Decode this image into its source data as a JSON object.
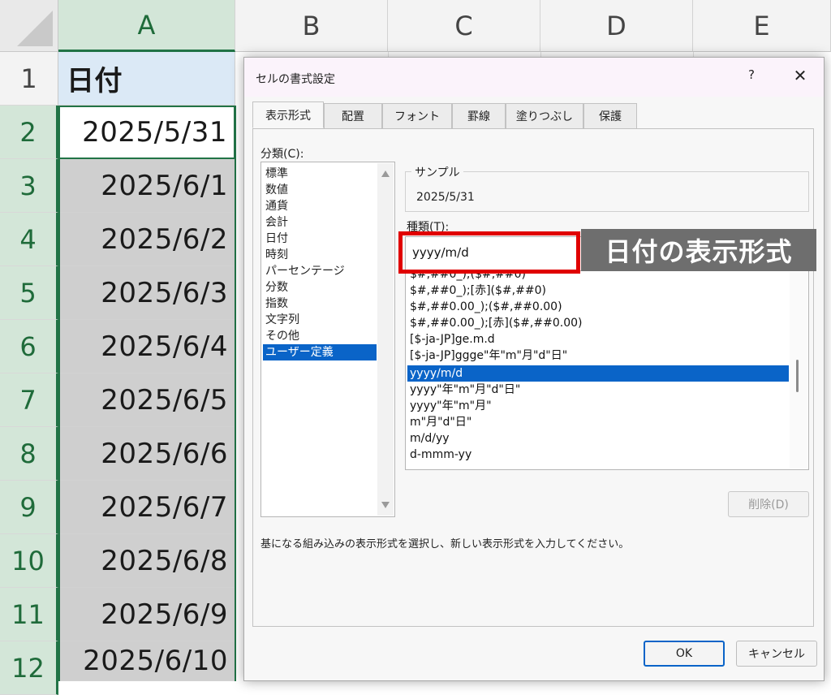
{
  "sheet": {
    "columns": [
      "A",
      "B",
      "C",
      "D",
      "E"
    ],
    "rows": [
      "1",
      "2",
      "3",
      "4",
      "5",
      "6",
      "7",
      "8",
      "9",
      "10",
      "11",
      "12"
    ],
    "cells": [
      "日付",
      "2025/5/31",
      "2025/6/1",
      "2025/6/2",
      "2025/6/3",
      "2025/6/4",
      "2025/6/5",
      "2025/6/6",
      "2025/6/7",
      "2025/6/8",
      "2025/6/9",
      "2025/6/10"
    ]
  },
  "dialog": {
    "title": "セルの書式設定",
    "help": "?",
    "close": "✕",
    "tabs": [
      "表示形式",
      "配置",
      "フォント",
      "罫線",
      "塗りつぶし",
      "保護"
    ],
    "category_label": "分類(C):",
    "categories": [
      "標準",
      "数値",
      "通貨",
      "会計",
      "日付",
      "時刻",
      "パーセンテージ",
      "分数",
      "指数",
      "文字列",
      "その他",
      "ユーザー定義"
    ],
    "selected_category": "ユーザー定義",
    "sample_label": "サンプル",
    "sample_value": "2025/5/31",
    "type_label": "種類(T):",
    "type_value": "yyyy/m/d",
    "formats": [
      "$#,##0_);($#,##0)",
      "$#,##0_);[赤]($#,##0)",
      "$#,##0.00_);($#,##0.00)",
      "$#,##0.00_);[赤]($#,##0.00)",
      "[$-ja-JP]ge.m.d",
      "[$-ja-JP]ggge\"年\"m\"月\"d\"日\"",
      "yyyy/m/d",
      "yyyy\"年\"m\"月\"d\"日\"",
      "yyyy\"年\"m\"月\"",
      "m\"月\"d\"日\"",
      "m/d/yy",
      "d-mmm-yy"
    ],
    "selected_format": "yyyy/m/d",
    "delete_label": "削除(D)",
    "description": "基になる組み込みの表示形式を選択し、新しい表示形式を入力してください。",
    "ok_label": "OK",
    "cancel_label": "キャンセル"
  },
  "callout": "日付の表示形式",
  "colors": {
    "accent_green": "#217346",
    "selection_blue": "#0a64c8",
    "highlight_red": "#e00000"
  }
}
